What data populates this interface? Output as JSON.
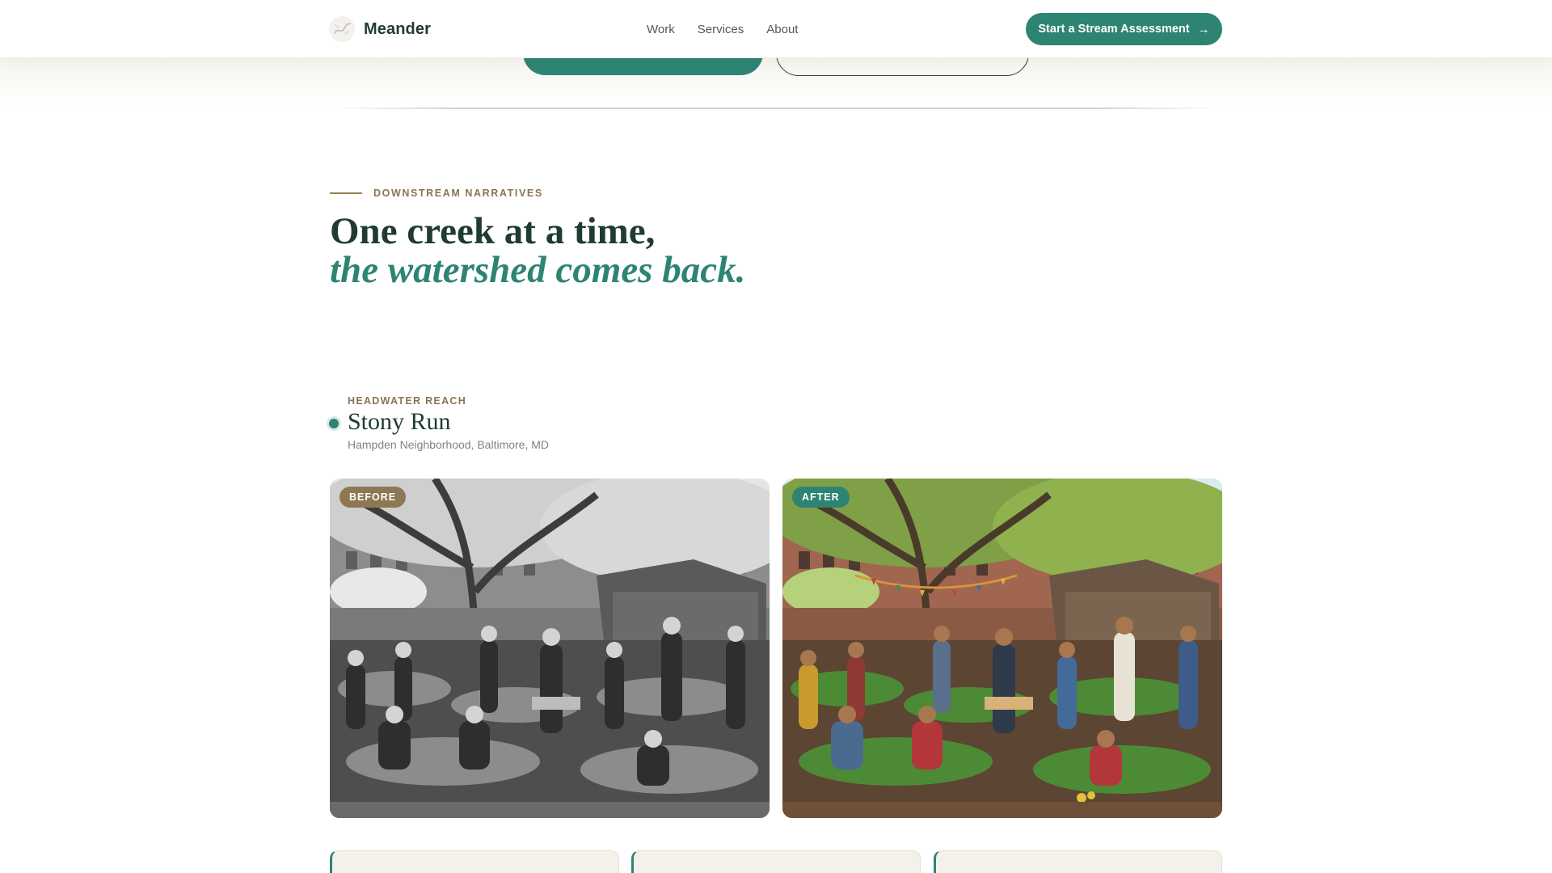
{
  "header": {
    "brand_name": "Meander",
    "nav": [
      "Work",
      "Services",
      "About"
    ],
    "cta_label": "Start a Stream Assessment",
    "cta_icon": "arrow-right-icon"
  },
  "section": {
    "eyebrow": "DOWNSTREAM NARRATIVES",
    "headline_line1": "One creek at a time,",
    "headline_line2": "the watershed comes back."
  },
  "reach": {
    "label": "HEADWATER REACH",
    "title": "Stony Run",
    "location": "Hampden Neighborhood, Baltimore, MD"
  },
  "photos": {
    "before_badge": "BEFORE",
    "after_badge": "AFTER"
  },
  "colors": {
    "accent": "#2e8473",
    "eyebrow": "#8a7452",
    "heading": "#1f3b33",
    "badge_before": "#8e7753"
  }
}
